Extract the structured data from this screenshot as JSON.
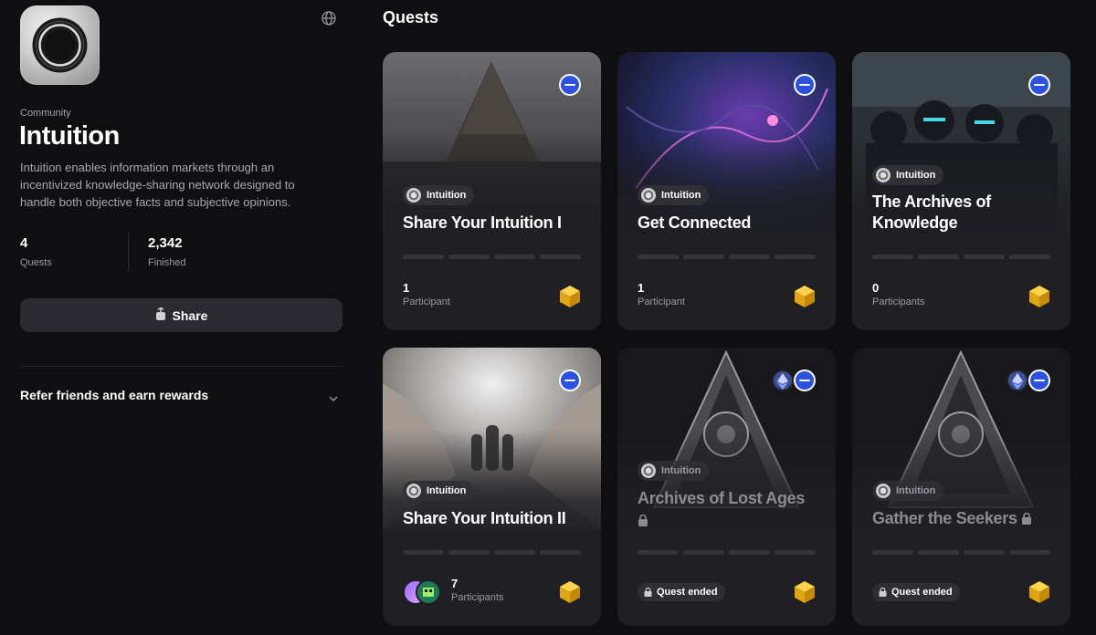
{
  "community": {
    "kicker": "Community",
    "name": "Intuition",
    "description": "Intuition enables information markets through an incentivized knowledge-sharing network designed to handle both objective facts and subjective opinions.",
    "stats": [
      {
        "value": "4",
        "label": "Quests"
      },
      {
        "value": "2,342",
        "label": "Finished"
      }
    ],
    "share_label": "Share",
    "refer_label": "Refer friends and earn rewards"
  },
  "quests_title": "Quests",
  "cards": [
    {
      "name": "Share Your Intuition I",
      "community": "Intuition",
      "count": "1",
      "count_label": "Participant"
    },
    {
      "name": "Get Connected",
      "community": "Intuition",
      "count": "1",
      "count_label": "Participant"
    },
    {
      "name": "The Archives of Knowledge",
      "community": "Intuition",
      "count": "0",
      "count_label": "Participants"
    },
    {
      "name": "Share Your Intuition II",
      "community": "Intuition",
      "count": "7",
      "count_label": "Participants"
    },
    {
      "name": "Archives of Lost Ages",
      "community": "Intuition",
      "status": "Quest ended"
    },
    {
      "name": "Gather the Seekers",
      "community": "Intuition",
      "status": "Quest ended"
    }
  ],
  "icons": {
    "globe": "globe-icon",
    "share": "share-icon",
    "chevron": "chevron-down-icon",
    "lock": "lock-icon",
    "reward": "reward-cube-icon",
    "chain": "chain-icon",
    "ethereum": "ethereum-icon"
  },
  "colors": {
    "background": "#0f0f12",
    "card": "#1f1f24",
    "chain_blue": "#2c50e0",
    "reward_gold": "#e8b21c"
  }
}
